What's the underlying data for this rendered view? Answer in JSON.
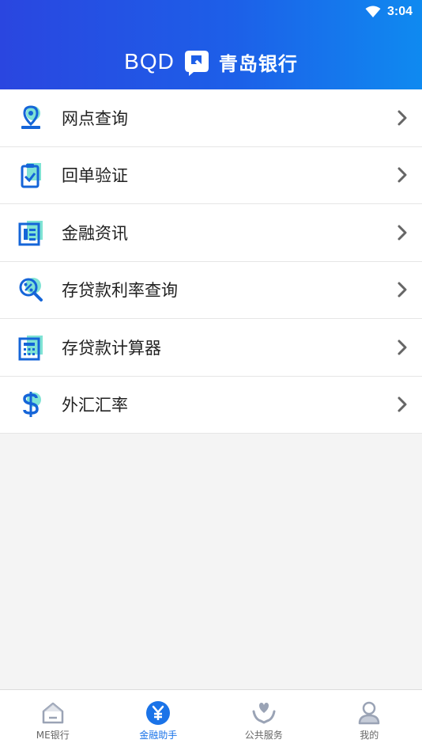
{
  "status_bar": {
    "time": "3:04",
    "icons": [
      "wifi-icon"
    ]
  },
  "header": {
    "brand_latin": "BQD",
    "brand_cn": "青岛银行",
    "logo_icon": "bqd-logo-icon"
  },
  "menu": [
    {
      "label": "网点查询",
      "icon": "location-pin-icon"
    },
    {
      "label": "回单验证",
      "icon": "clipboard-check-icon"
    },
    {
      "label": "金融资讯",
      "icon": "news-icon"
    },
    {
      "label": "存贷款利率查询",
      "icon": "rate-search-icon"
    },
    {
      "label": "存贷款计算器",
      "icon": "calculator-icon"
    },
    {
      "label": "外汇汇率",
      "icon": "dollar-icon"
    }
  ],
  "tabbar": [
    {
      "label": "ME银行",
      "icon": "home-icon",
      "active": false
    },
    {
      "label": "金融助手",
      "icon": "yuan-icon",
      "active": true
    },
    {
      "label": "公共服务",
      "icon": "heart-hands-icon",
      "active": false
    },
    {
      "label": "我的",
      "icon": "person-icon",
      "active": false
    }
  ],
  "colors": {
    "accent": "#1a73e8",
    "header_start": "#2a46e0",
    "header_end": "#0f8af0",
    "icon_accent": "#1ec8b8"
  }
}
